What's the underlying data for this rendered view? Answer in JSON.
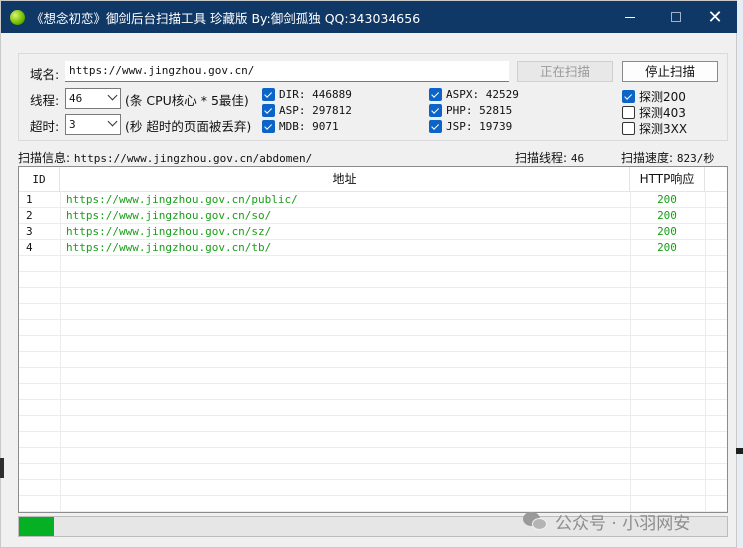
{
  "window": {
    "title": "《想念初恋》御剑后台扫描工具 珍藏版 By:御剑孤独 QQ:343034656",
    "close_glyph": "✕"
  },
  "form": {
    "domain_label": "域名:",
    "domain_value": "https://www.jingzhou.gov.cn/",
    "threads_label": "线程:",
    "threads_value": "46",
    "threads_hint": "(条 CPU核心 * 5最佳)",
    "timeout_label": "超时:",
    "timeout_value": "3",
    "timeout_hint": "(秒 超时的页面被丢弃)",
    "scanning_button": "正在扫描",
    "stop_button": "停止扫描"
  },
  "dictionaries": [
    {
      "label": "DIR: 446889",
      "checked": true
    },
    {
      "label": "ASP: 297812",
      "checked": true
    },
    {
      "label": "MDB: 9071",
      "checked": true
    },
    {
      "label": "ASPX: 42529",
      "checked": true
    },
    {
      "label": "PHP: 52815",
      "checked": true
    },
    {
      "label": "JSP: 19739",
      "checked": true
    }
  ],
  "probes": [
    {
      "label": "探测200",
      "checked": true
    },
    {
      "label": "探测403",
      "checked": false
    },
    {
      "label": "探测3XX",
      "checked": false
    }
  ],
  "status": {
    "info_label": "扫描信息:",
    "info_value": "https://www.jingzhou.gov.cn/abdomen/",
    "threads_label": "扫描线程:",
    "threads_value": "46",
    "speed_label": "扫描速度:",
    "speed_value": "823/秒"
  },
  "table": {
    "columns": [
      "ID",
      "地址",
      "HTTP响应"
    ],
    "rows": [
      {
        "id": "1",
        "url": "https://www.jingzhou.gov.cn/public/",
        "code": "200"
      },
      {
        "id": "2",
        "url": "https://www.jingzhou.gov.cn/so/",
        "code": "200"
      },
      {
        "id": "3",
        "url": "https://www.jingzhou.gov.cn/sz/",
        "code": "200"
      },
      {
        "id": "4",
        "url": "https://www.jingzhou.gov.cn/tb/",
        "code": "200"
      }
    ],
    "empty_rows": 17
  },
  "progress": {
    "fraction": 0.05
  },
  "watermark": {
    "text": "公众号 · 小羽网安"
  },
  "colors": {
    "titlebar": "#0f3866",
    "result_text": "#18a018",
    "progress_fill": "#06b025",
    "checkbox": "#0c64c8"
  }
}
